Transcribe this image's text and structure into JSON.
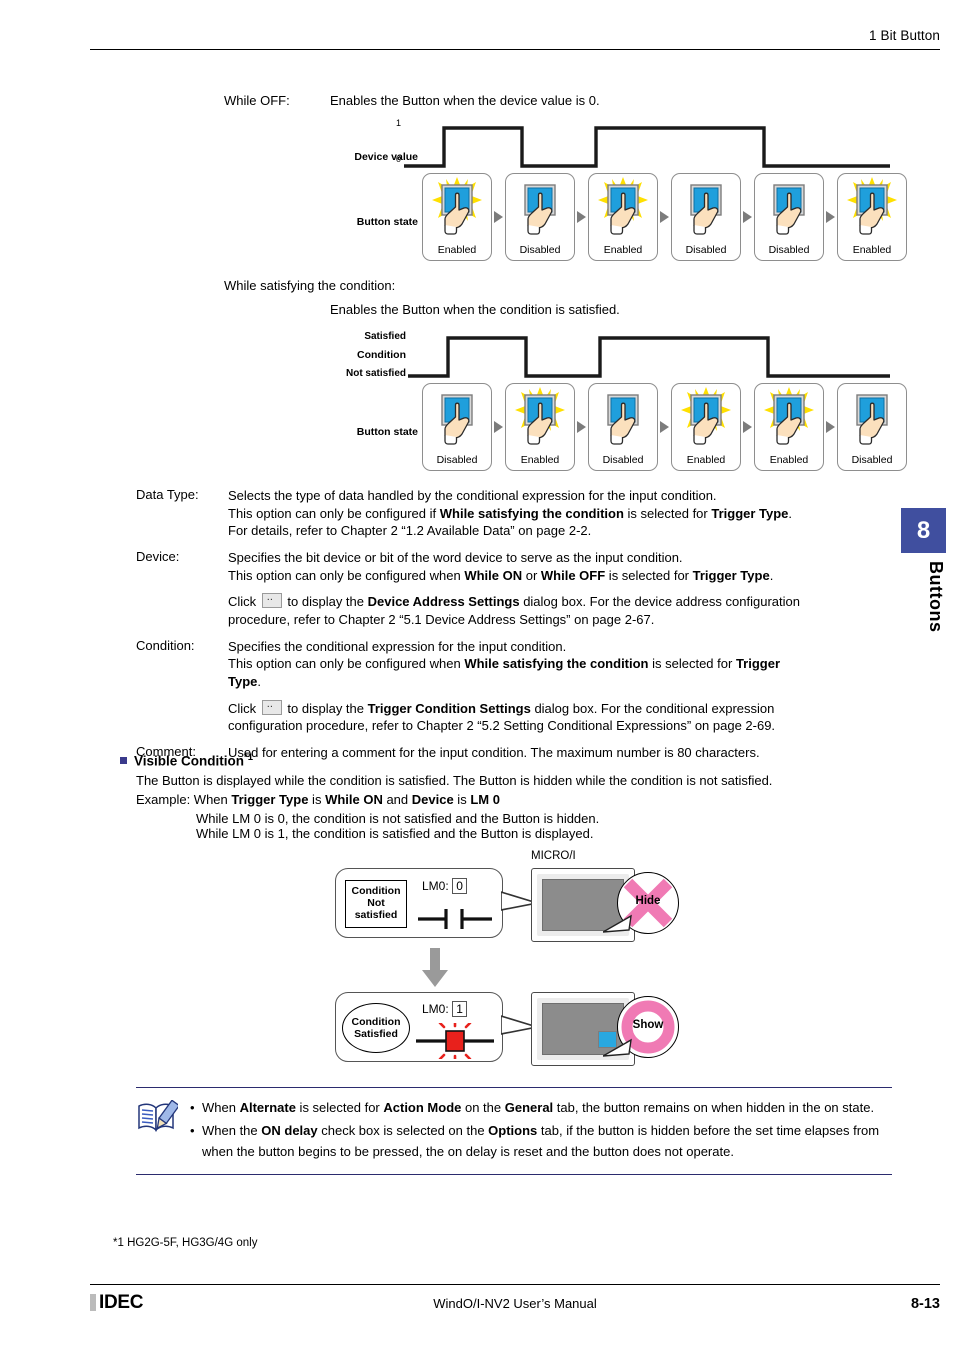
{
  "header": {
    "title": "1 Bit Button"
  },
  "side_tab": {
    "chapter_number": "8",
    "label": "Buttons",
    "color": "#404f9f"
  },
  "while_off": {
    "term": "While OFF:",
    "description": "Enables the Button when the device value is 0.",
    "diagram": {
      "signal_label": "Device value",
      "tick_high": "1",
      "tick_low": "0",
      "state_row_label": "Button state",
      "states": [
        "Enabled",
        "Disabled",
        "Enabled",
        "Disabled",
        "Disabled",
        "Enabled"
      ],
      "state_icons": [
        "burst-enabled-icon",
        "plain-disabled-icon",
        "burst-enabled-icon",
        "plain-disabled-icon",
        "plain-disabled-icon",
        "burst-enabled-icon"
      ],
      "waveform_levels": [
        0,
        1,
        0,
        1,
        1,
        0
      ]
    }
  },
  "while_condition": {
    "term": "While satisfying the condition:",
    "description": "Enables the Button when the condition is satisfied.",
    "diagram": {
      "signal_label": "Condition",
      "tick_high": "Satisfied",
      "tick_low": "Not satisfied",
      "state_row_label": "Button state",
      "states": [
        "Disabled",
        "Enabled",
        "Disabled",
        "Enabled",
        "Enabled",
        "Disabled"
      ],
      "state_icons": [
        "plain-disabled-icon",
        "burst-enabled-icon",
        "plain-disabled-icon",
        "burst-enabled-icon",
        "burst-enabled-icon",
        "plain-disabled-icon"
      ],
      "waveform_levels": [
        0,
        1,
        0,
        1,
        1,
        0
      ]
    }
  },
  "definitions": [
    {
      "term": "Data Type:",
      "paragraphs": [
        [
          {
            "t": "Selects the type of data handled by the conditional expression for the input condition."
          },
          {
            "br": true
          },
          {
            "t": "This option can only be configured if "
          },
          {
            "t": "While satisfying the condition",
            "b": true
          },
          {
            "t": " is selected for "
          },
          {
            "t": "Trigger Type",
            "b": true
          },
          {
            "t": "."
          },
          {
            "br": true
          },
          {
            "t": "For details, refer to Chapter 2 “1.2 Available Data” on page 2-2."
          }
        ]
      ]
    },
    {
      "term": "Device:",
      "paragraphs": [
        [
          {
            "t": "Specifies the bit device or bit of the word device to serve as the input condition."
          },
          {
            "br": true
          },
          {
            "t": "This option can only be configured when "
          },
          {
            "t": "While ON",
            "b": true
          },
          {
            "t": " or "
          },
          {
            "t": "While OFF",
            "b": true
          },
          {
            "t": " is selected for "
          },
          {
            "t": "Trigger Type",
            "b": true
          },
          {
            "t": "."
          }
        ],
        [
          {
            "t": "Click "
          },
          {
            "btn": ".."
          },
          {
            "t": " to display the "
          },
          {
            "t": "Device Address Settings",
            "b": true
          },
          {
            "t": " dialog box. For the device address configuration"
          },
          {
            "br": true
          },
          {
            "t": "procedure, refer to Chapter 2 “5.1 Device Address Settings” on page 2-67."
          }
        ]
      ]
    },
    {
      "term": "Condition:",
      "paragraphs": [
        [
          {
            "t": "Specifies the conditional expression for the input condition."
          },
          {
            "br": true
          },
          {
            "t": "This option can only be configured when "
          },
          {
            "t": "While satisfying the condition",
            "b": true
          },
          {
            "t": " is selected for "
          },
          {
            "t": "Trigger",
            "b": true
          },
          {
            "br": true
          },
          {
            "t": "Type",
            "b": true
          },
          {
            "t": "."
          }
        ],
        [
          {
            "t": "Click "
          },
          {
            "btn": ".."
          },
          {
            "t": " to display the "
          },
          {
            "t": "Trigger Condition Settings",
            "b": true
          },
          {
            "t": " dialog box. For the conditional expression"
          },
          {
            "br": true
          },
          {
            "t": "configuration procedure, refer to Chapter 2 “5.2 Setting Conditional Expressions” on page 2-69."
          }
        ]
      ]
    },
    {
      "term": "Comment:",
      "paragraphs": [
        [
          {
            "t": "Used for entering a comment for the input condition. The maximum number is 80 characters."
          }
        ]
      ]
    }
  ],
  "visible_condition": {
    "heading": "Visible Condition",
    "heading_footnote": "*1",
    "line1": "The Button is displayed while the condition is satisfied. The Button is hidden while the condition is not satisfied.",
    "example_prefix": "Example: When ",
    "example_parts": [
      {
        "t": "Example: When "
      },
      {
        "t": "Trigger Type",
        "b": true
      },
      {
        "t": " is "
      },
      {
        "t": "While ON",
        "b": true
      },
      {
        "t": " and "
      },
      {
        "t": "Device",
        "b": true
      },
      {
        "t": " is "
      },
      {
        "t": "LM 0",
        "b": true
      }
    ],
    "example_line2": "While LM 0 is 0, the condition is not satisfied and the Button is hidden.",
    "example_line3": "While LM 0 is 1, the condition is satisfied and the Button is displayed.",
    "diagram": {
      "device_label": "MICRO/I",
      "top": {
        "condition_label": [
          "Condition",
          "Not",
          "satisfied"
        ],
        "device_name": "LM0:",
        "device_value": "0",
        "contact_type": "open-contact",
        "badge_text": "Hide",
        "badge_icon": "cross-icon",
        "badge_color": "#f07ab4",
        "screen_button_visible": false
      },
      "bottom": {
        "condition_label": [
          "Condition",
          "Satisfied"
        ],
        "device_name": "LM0:",
        "device_value": "1",
        "contact_type": "closed-contact-active",
        "badge_text": "Show",
        "badge_icon": "ring-icon",
        "badge_color": "#f07ab4",
        "screen_button_visible": true,
        "screen_button_color": "#29a8e0"
      }
    }
  },
  "note": {
    "icon": "note-pencil-icon",
    "items": [
      [
        {
          "t": "When "
        },
        {
          "t": "Alternate",
          "b": true
        },
        {
          "t": " is selected for "
        },
        {
          "t": "Action Mode",
          "b": true
        },
        {
          "t": " on the "
        },
        {
          "t": "General",
          "b": true
        },
        {
          "t": " tab, the button remains on when hidden in the on state."
        }
      ],
      [
        {
          "t": "When the "
        },
        {
          "t": "ON delay",
          "b": true
        },
        {
          "t": " check box is selected on the "
        },
        {
          "t": "Options",
          "b": true
        },
        {
          "t": " tab, if the button is hidden before the set time elapses from when the button begins to be pressed, the on delay is reset and the button does not operate."
        }
      ]
    ]
  },
  "footnote": "*1  HG2G-5F, HG3G/4G only",
  "footer": {
    "brand": "IDEC",
    "center": "WindO/I-NV2 User’s Manual",
    "page": "8-13"
  }
}
